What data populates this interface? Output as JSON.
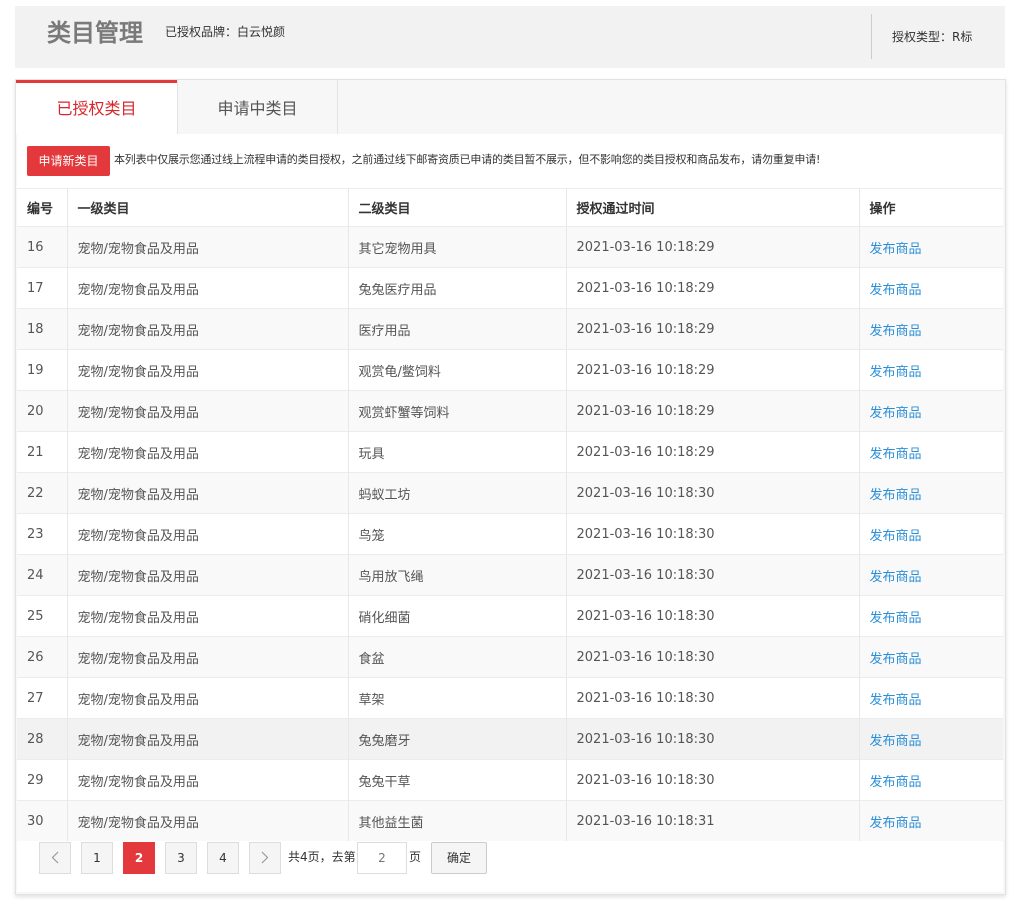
{
  "header": {
    "title": "类目管理",
    "brand": "已授权品牌：白云悦颜",
    "auth_type": "授权类型：R标"
  },
  "tabs": [
    {
      "label": "已授权类目",
      "active": true
    },
    {
      "label": "申请中类目",
      "active": false
    }
  ],
  "toolbar": {
    "apply_label": "申请新类目",
    "notice": "本列表中仅展示您通过线上流程申请的类目授权，之前通过线下邮寄资质已申请的类目暂不展示，但不影响您的类目授权和商品发布，请勿重复申请!"
  },
  "table": {
    "columns": [
      "编号",
      "一级类目",
      "二级类目",
      "授权通过时间",
      "操作"
    ],
    "rows": [
      [
        "16",
        "宠物/宠物食品及用品",
        "其它宠物用具",
        "2021-03-16 10:18:29",
        "发布商品"
      ],
      [
        "17",
        "宠物/宠物食品及用品",
        "兔兔医疗用品",
        "2021-03-16 10:18:29",
        "发布商品"
      ],
      [
        "18",
        "宠物/宠物食品及用品",
        "医疗用品",
        "2021-03-16 10:18:29",
        "发布商品"
      ],
      [
        "19",
        "宠物/宠物食品及用品",
        "观赏龟/鳖饲料",
        "2021-03-16 10:18:29",
        "发布商品"
      ],
      [
        "20",
        "宠物/宠物食品及用品",
        "观赏虾蟹等饲料",
        "2021-03-16 10:18:29",
        "发布商品"
      ],
      [
        "21",
        "宠物/宠物食品及用品",
        "玩具",
        "2021-03-16 10:18:29",
        "发布商品"
      ],
      [
        "22",
        "宠物/宠物食品及用品",
        "蚂蚁工坊",
        "2021-03-16 10:18:30",
        "发布商品"
      ],
      [
        "23",
        "宠物/宠物食品及用品",
        "鸟笼",
        "2021-03-16 10:18:30",
        "发布商品"
      ],
      [
        "24",
        "宠物/宠物食品及用品",
        "鸟用放飞绳",
        "2021-03-16 10:18:30",
        "发布商品"
      ],
      [
        "25",
        "宠物/宠物食品及用品",
        "硝化细菌",
        "2021-03-16 10:18:30",
        "发布商品"
      ],
      [
        "26",
        "宠物/宠物食品及用品",
        "食盆",
        "2021-03-16 10:18:30",
        "发布商品"
      ],
      [
        "27",
        "宠物/宠物食品及用品",
        "草架",
        "2021-03-16 10:18:30",
        "发布商品"
      ],
      [
        "28",
        "宠物/宠物食品及用品",
        "兔兔磨牙",
        "2021-03-16 10:18:30",
        "发布商品"
      ],
      [
        "29",
        "宠物/宠物食品及用品",
        "兔兔干草",
        "2021-03-16 10:18:30",
        "发布商品"
      ],
      [
        "30",
        "宠物/宠物食品及用品",
        "其他益生菌",
        "2021-03-16 10:18:31",
        "发布商品"
      ]
    ]
  },
  "pagination": {
    "pages": [
      "1",
      "2",
      "3",
      "4"
    ],
    "current": "2",
    "total_text": "共4页，去第",
    "input_placeholder": "2",
    "page_suffix": "页",
    "confirm_label": "确定"
  },
  "colors": {
    "accent": "#e4393c",
    "link": "#2a8fd8"
  }
}
